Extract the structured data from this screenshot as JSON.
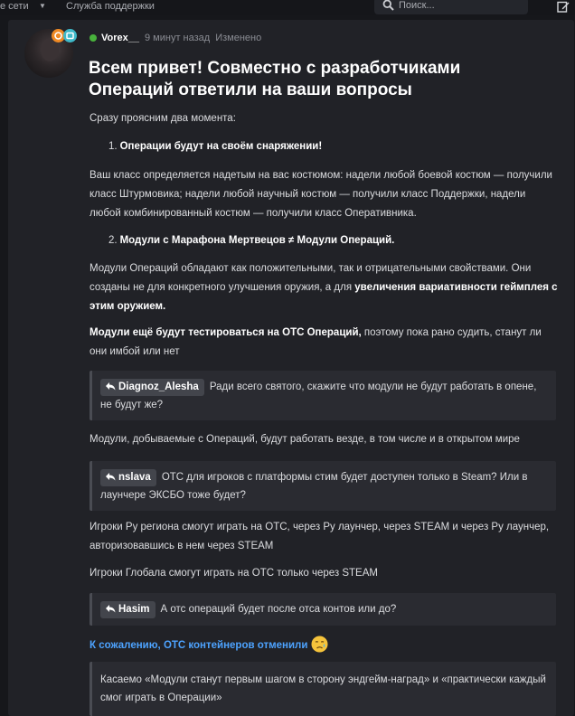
{
  "topbar": {
    "nav_left": "е сети",
    "nav_support": "Служба поддержки",
    "search_placeholder": "Поиск..."
  },
  "post": {
    "author": "Vorex__",
    "time": "9 минут назад",
    "edited": "Изменено",
    "title": "Всем привет! Совместно с разработчиками Операций ответили на ваши вопросы",
    "intro": "Сразу проясним два момента:",
    "item1_num": "1.",
    "item1": "Операции будут на своём снаряжении!",
    "para_class": "Ваш класс определяется надетым на вас костюмом: надели любой боевой костюм — получили класс Штурмовика; надели любой научный костюм — получили класс Поддержки, надели любой комбинированный костюм — получили класс Оперативника.",
    "item2_num": "2.",
    "item2": "Модули с Марафона Мертвецов ≠ Модули Операций.",
    "para_modules_a": "Модули Операций обладают как положительными, так и отрицательными свойствами. Они созданы не для конкретного улучшения оружия, а для ",
    "para_modules_b": "увеличения вариативности геймплея с этим оружием.",
    "para_test_b": "Модули ещё будут тестироваться на ОТС Операций,",
    "para_test_a": " поэтому пока рано судить, станут ли они имбой или нет",
    "quote1_user": "Diagnoz_Alesha",
    "quote1_text": "Ради всего святого, скажите что модули не будут работать в опене, не будут же?",
    "answer1": "Модули, добываемые с Операций, будут работать везде, в том числе и в открытом мире",
    "quote2_user": "nslava",
    "quote2_text": "ОТС для игроков с платформы стим будет доступен только в Steam? Или в лаунчере ЭКСБО тоже будет?",
    "answer2a": "Игроки Ру региона смогут играть на ОТС, через Ру лаунчер, через STEAM и через Ру лаунчер, авторизовавшись в нем через STEAM",
    "answer2b": "Игроки Глобала смогут играть на ОТС только через STEAM",
    "quote3_user": "Hasim",
    "quote3_text": "А отс операций будет после отса контов или до?",
    "answer3": "К сожалению, ОТС контейнеров отменили",
    "quote4_text": "Касаемо «Модули станут первым шагом в сторону эндгейм-наград» и «практически каждый смог играть в Операции»"
  },
  "colors": {
    "background": "#16171b",
    "card": "#212227",
    "quote_bg": "#2a2b31",
    "online_dot": "#48b23c",
    "link_blue": "#4da3ff"
  },
  "icons": [
    "search-icon",
    "edit-icon",
    "reply-arrow-icon",
    "crying-emoji-icon",
    "online-status-icon",
    "chevron-down-icon"
  ]
}
